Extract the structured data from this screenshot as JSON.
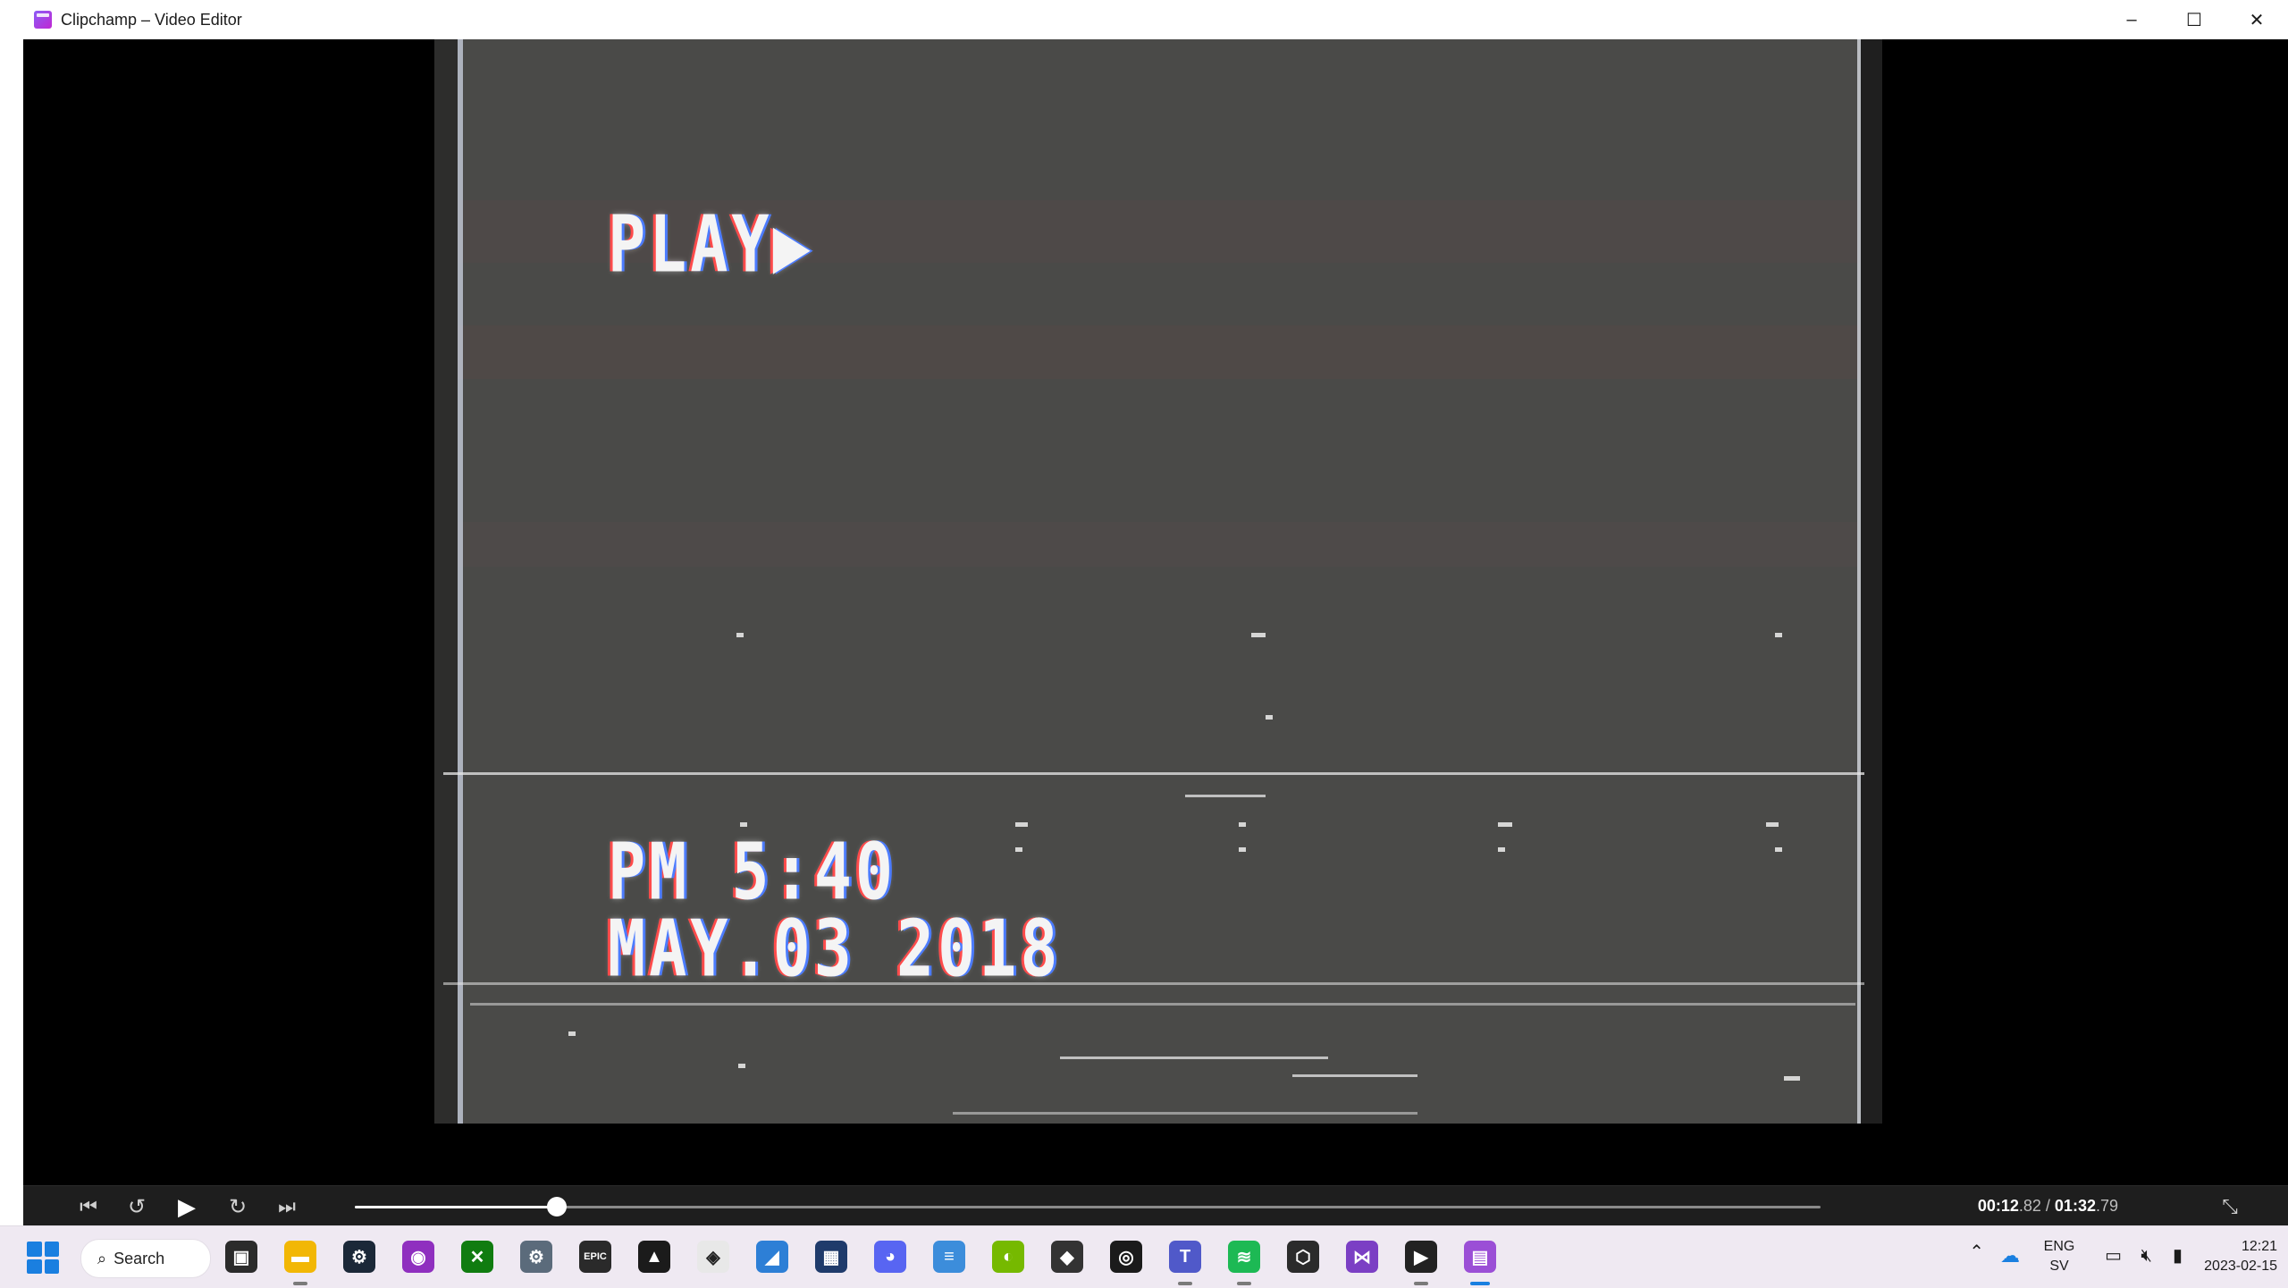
{
  "window": {
    "title": "Clipchamp – Video Editor",
    "controls": {
      "minimize": "–",
      "maximize": "☐",
      "close": "✕"
    }
  },
  "video": {
    "overlay_play": "PLAY▶",
    "overlay_time": "PM 5:40",
    "overlay_date": "MAY.03 2018"
  },
  "player": {
    "current_time_main": "00:12",
    "current_time_frac": ".82",
    "separator": " / ",
    "total_time_main": "01:32",
    "total_time_frac": ".79",
    "progress_fraction": 0.138,
    "icons": [
      "skip-back-icon",
      "rewind-5-icon",
      "play-icon",
      "forward-5-icon",
      "skip-forward-icon",
      "exit-fullscreen-icon"
    ]
  },
  "taskbar": {
    "search_label": "Search",
    "apps": [
      {
        "name": "task-view",
        "color": "#2b2b2b",
        "glyph": "▣",
        "running": false
      },
      {
        "name": "file-explorer",
        "color": "#f2b705",
        "glyph": "▬",
        "running": true
      },
      {
        "name": "steam",
        "color": "#1b2838",
        "glyph": "⚙",
        "running": false
      },
      {
        "name": "app-purple",
        "color": "#8f2fbf",
        "glyph": "◉",
        "running": false
      },
      {
        "name": "xbox",
        "color": "#107c10",
        "glyph": "✕",
        "running": false
      },
      {
        "name": "settings",
        "color": "#5b6b7b",
        "glyph": "⚙",
        "running": false
      },
      {
        "name": "epic-games",
        "color": "#2a2a2a",
        "glyph": "EPIC",
        "running": false
      },
      {
        "name": "nvidia-app",
        "color": "#1b1b1b",
        "glyph": "▲",
        "running": false
      },
      {
        "name": "unity-hub",
        "color": "#e8e8e8",
        "glyph": "◈",
        "running": false
      },
      {
        "name": "paint-app",
        "color": "#2d7fd6",
        "glyph": "◢",
        "running": false
      },
      {
        "name": "video-app",
        "color": "#1f3b6b",
        "glyph": "▦",
        "running": false
      },
      {
        "name": "discord",
        "color": "#5865f2",
        "glyph": "◕",
        "running": false
      },
      {
        "name": "notepad",
        "color": "#3c8ddb",
        "glyph": "≡",
        "running": false
      },
      {
        "name": "nvidia",
        "color": "#76b900",
        "glyph": "◐",
        "running": false
      },
      {
        "name": "inkscape",
        "color": "#333333",
        "glyph": "◆",
        "running": false
      },
      {
        "name": "uplay",
        "color": "#1b1b1b",
        "glyph": "◎",
        "running": false
      },
      {
        "name": "teams",
        "color": "#5059c9",
        "glyph": "T",
        "running": true
      },
      {
        "name": "spotify",
        "color": "#1db954",
        "glyph": "≋",
        "running": true
      },
      {
        "name": "unity",
        "color": "#2b2b2b",
        "glyph": "⬡",
        "running": false
      },
      {
        "name": "visual-studio",
        "color": "#7b3fc4",
        "glyph": "⋈",
        "running": false
      },
      {
        "name": "media-player",
        "color": "#222222",
        "glyph": "▶",
        "running": true
      },
      {
        "name": "clipchamp",
        "color": "#9b4fd6",
        "glyph": "▤",
        "running": true,
        "current": true
      }
    ],
    "tray": {
      "lang_top": "ENG",
      "lang_bottom": "SV",
      "time": "12:21",
      "date": "2023-02-15"
    }
  }
}
